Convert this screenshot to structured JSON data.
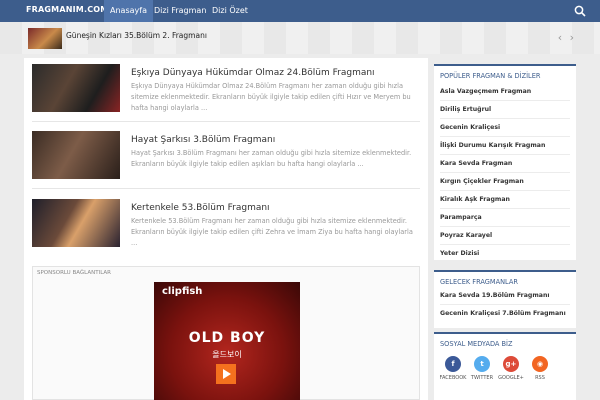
{
  "header": {
    "brand": "FRAGMANIM.COM",
    "nav": [
      "Anasayfa",
      "Dizi Fragman",
      "Dizi Özet"
    ],
    "search_icon": "search-icon"
  },
  "ticker": {
    "text": "Güneşin Kızları 35.Bölüm 2. Fragmanı",
    "arrows": "‹ ›"
  },
  "posts": [
    {
      "title": "Eşkıya Dünyaya Hükümdar Olmaz 24.Bölüm Fragmanı",
      "excerpt": "Eşkıya Dünyaya Hükümdar Olmaz 24.Bölüm Fragmanı her zaman olduğu gibi hızla sitemize eklenmektedir. Ekranların büyük ilgiyle takip edilen çifti Hızır ve Meryem bu hafta hangi olaylarla ..."
    },
    {
      "title": "Hayat Şarkısı 3.Bölüm Fragmanı",
      "excerpt": "Hayat Şarkısı 3.Bölüm Fragmanı her zaman olduğu gibi hızla sitemize eklenmektedir. Ekranların büyük ilgiyle takip edilen aşıkları bu hafta hangi olaylarla ..."
    },
    {
      "title": "Kertenkele 53.Bölüm Fragmanı",
      "excerpt": "Kertenkele 53.Bölüm Fragmanı her zaman olduğu gibi hızla sitemize eklenmektedir. Ekranların büyük ilgiyle takip edilen çifti Zehra ve İmam Ziya bu hafta hangi olaylarla ..."
    }
  ],
  "sponsor": {
    "label": "SPONSORLU BAĞLANTILAR",
    "ad": {
      "logo": "clipfish",
      "title": "OLD BOY",
      "subtitle": "올드보이"
    }
  },
  "sidebar": {
    "popular": {
      "title": "POPÜLER FRAGMAN & DİZİLER",
      "items": [
        "Asla Vazgeçmem Fragman",
        "Diriliş Ertuğrul",
        "Gecenin Kraliçesi",
        "İlişki Durumu Karışık Fragman",
        "Kara Sevda Fragman",
        "Kırgın Çiçekler Fragman",
        "Kiralık Aşk Fragman",
        "Paramparça",
        "Poyraz Karayel",
        "Yeter Dizisi"
      ]
    },
    "upcoming": {
      "title": "GELECEK FRAGMANLAR",
      "items": [
        "Kara Sevda 19.Bölüm Fragmanı",
        "Gecenin Kraliçesi 7.Bölüm Fragmanı"
      ]
    },
    "social": {
      "title": "SOSYAL MEDYADA BİZ",
      "items": [
        {
          "label": "FACEBOOK",
          "glyph": "f",
          "color": "#3b5998",
          "icon": "facebook-icon"
        },
        {
          "label": "TWITTER",
          "glyph": "t",
          "color": "#55acee",
          "icon": "twitter-icon"
        },
        {
          "label": "GOOGLE+",
          "glyph": "g+",
          "color": "#dd4b39",
          "icon": "google-plus-icon"
        },
        {
          "label": "RSS",
          "glyph": "◉",
          "color": "#f26522",
          "icon": "rss-icon"
        }
      ]
    }
  },
  "colors": {
    "accent": "#3d5d8c",
    "nav_active": "#4f74ab"
  }
}
